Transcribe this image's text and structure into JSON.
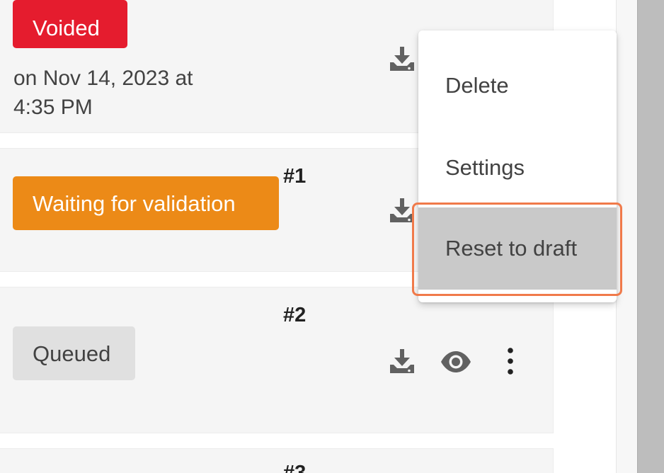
{
  "cards": [
    {
      "status": "Voided",
      "status_color": "#e51c2e",
      "date": "on Nov 14, 2023 at\n4:35 PM"
    },
    {
      "status": "Waiting for validation",
      "status_color": "#ec8a17",
      "number": "#1"
    },
    {
      "status": "Queued",
      "status_color": "#e0e0e0",
      "number": "#2"
    },
    {
      "number": "#3"
    }
  ],
  "menu": {
    "items": [
      {
        "label": "Delete"
      },
      {
        "label": "Settings"
      },
      {
        "label": "Reset to draft",
        "highlighted": true
      }
    ]
  },
  "icons": {
    "download": "download-icon",
    "view": "eye-icon",
    "more": "more-vertical-icon"
  },
  "colors": {
    "highlight_outline": "#f07a4a"
  }
}
